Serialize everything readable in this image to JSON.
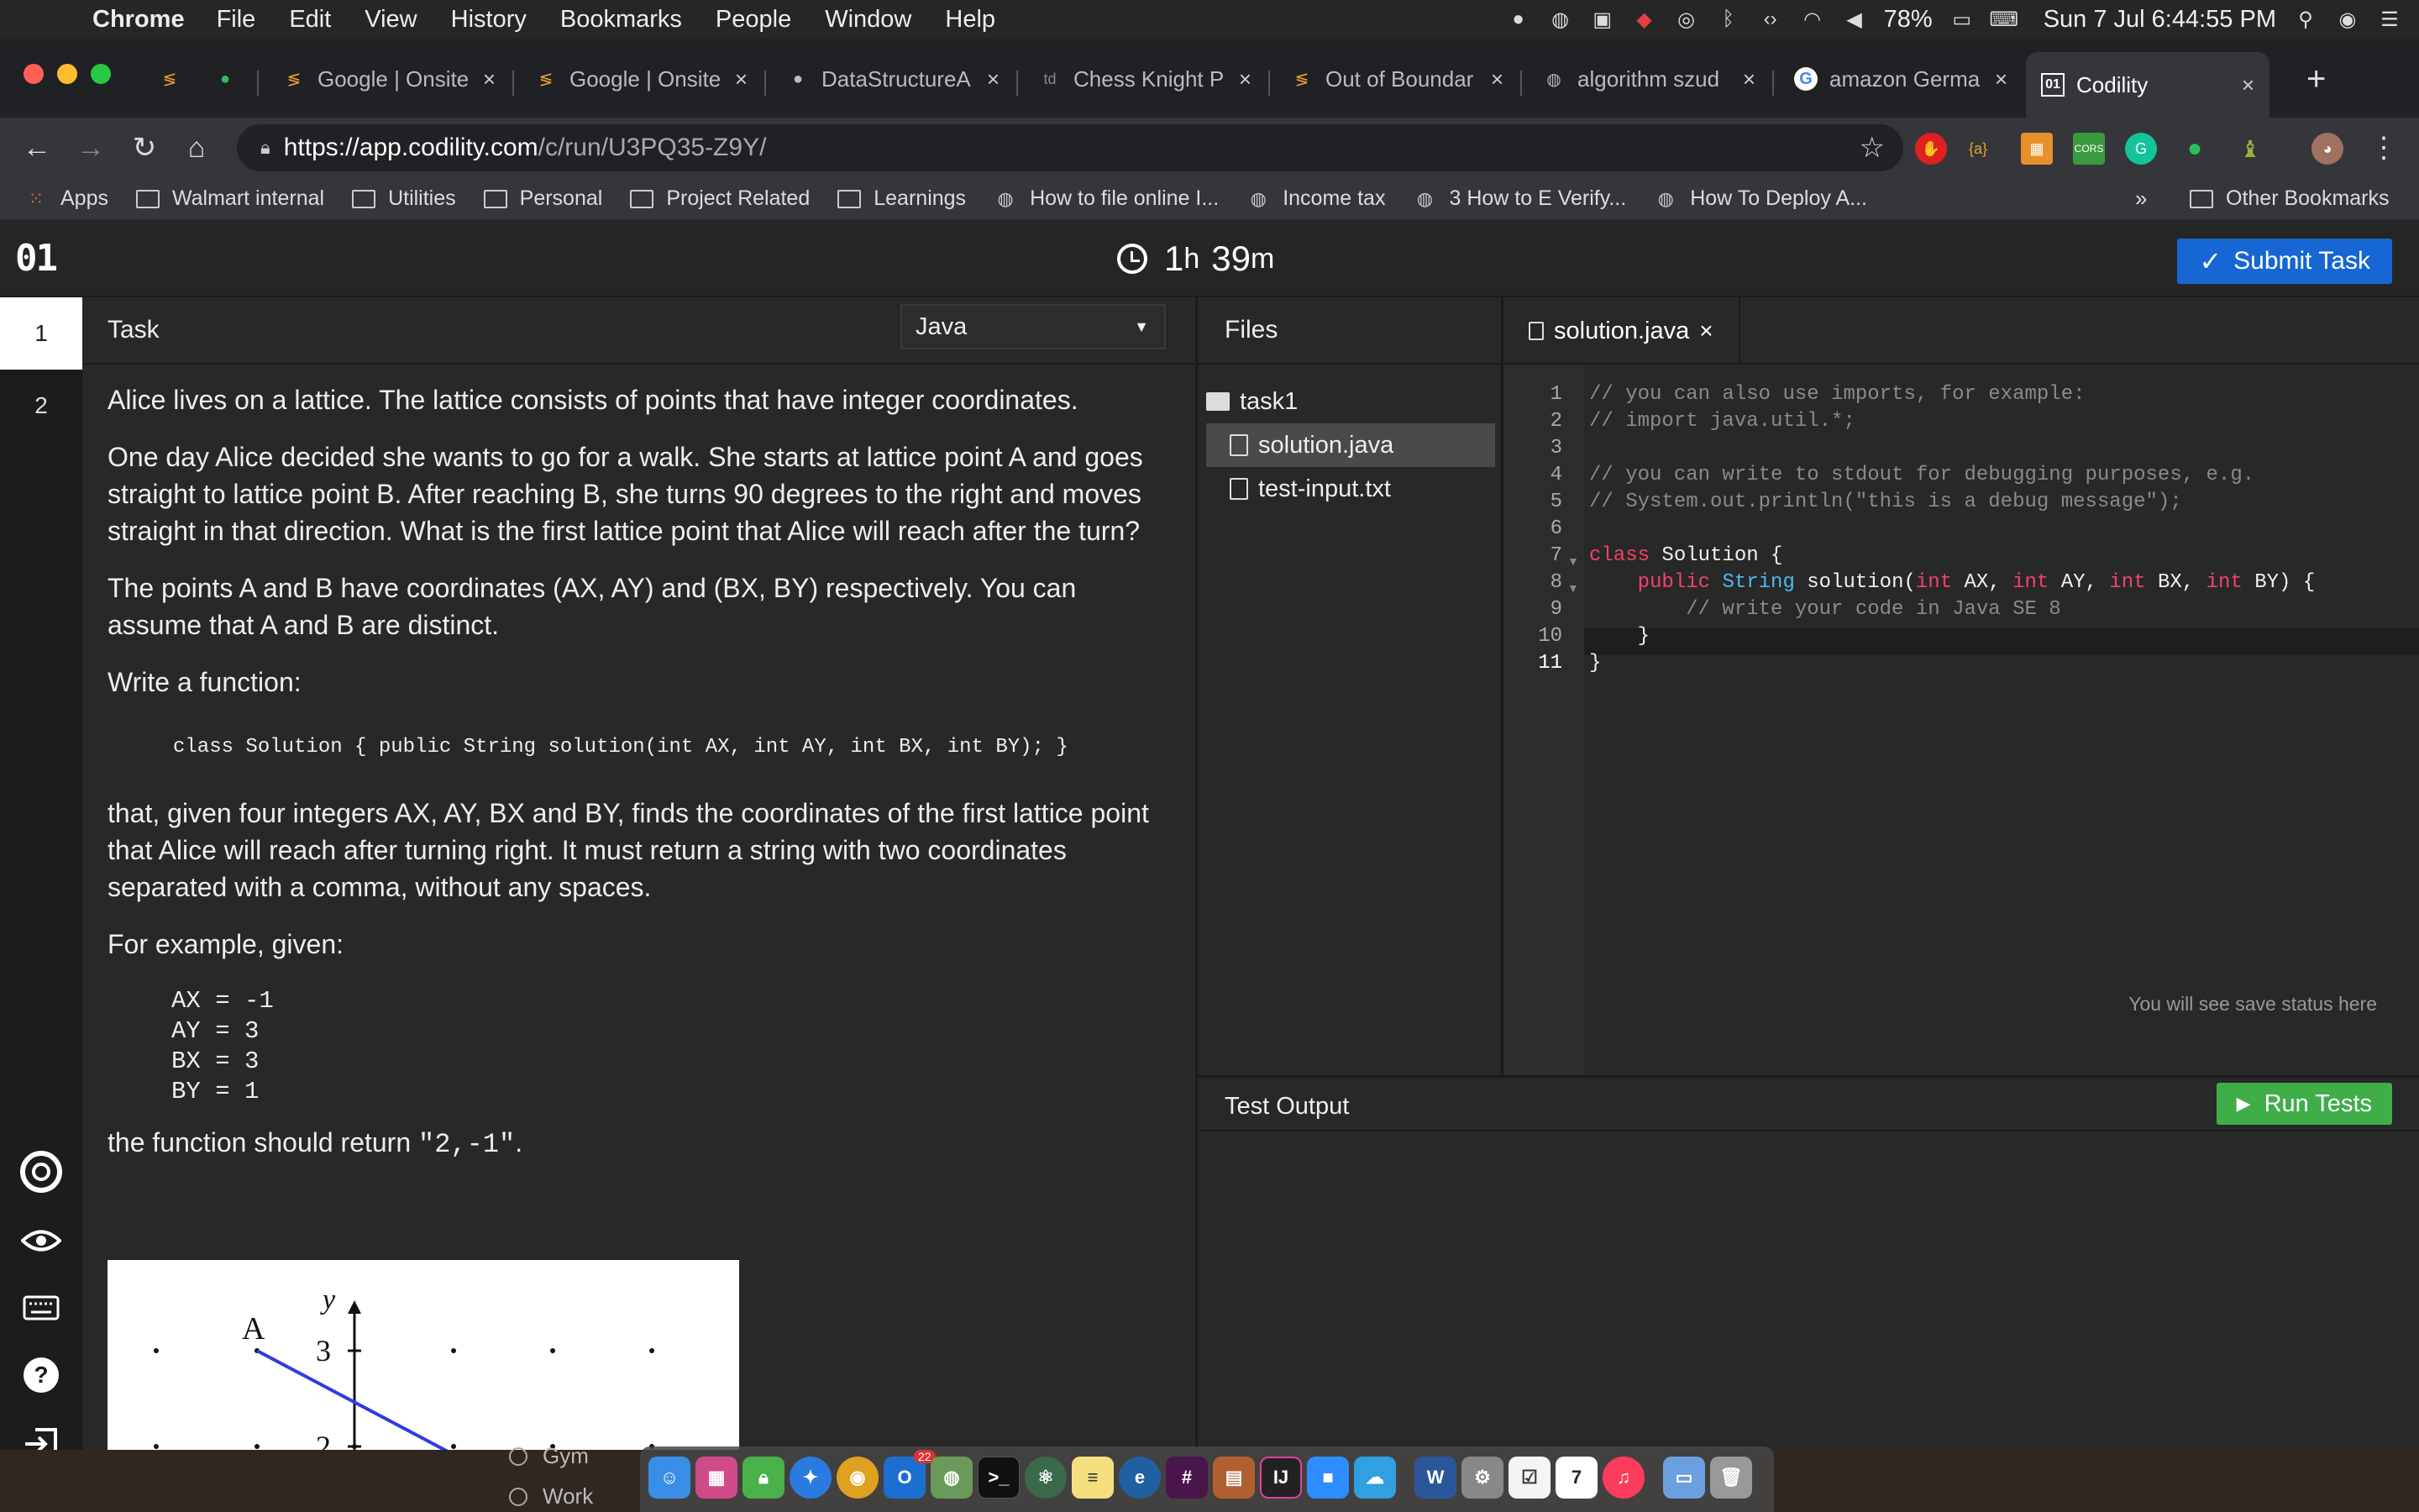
{
  "menubar": {
    "app": "Chrome",
    "items": [
      "File",
      "Edit",
      "View",
      "History",
      "Bookmarks",
      "People",
      "Window",
      "Help"
    ],
    "battery": "78%",
    "datetime": "Sun 7 Jul  6:44:55 PM"
  },
  "tabs": [
    {
      "label": "Google | Onsite",
      "icon": "sigma-icon"
    },
    {
      "label": "Google | Onsite",
      "icon": "sigma-icon"
    },
    {
      "label": "DataStructureA",
      "icon": "github-icon"
    },
    {
      "label": "Chess Knight P",
      "icon": "td-icon"
    },
    {
      "label": "Out of Boundar",
      "icon": "sigma-icon"
    },
    {
      "label": "algorithm szud",
      "icon": "globe-icon"
    },
    {
      "label": "amazon Germa",
      "icon": "google-icon"
    },
    {
      "label": "Codility",
      "icon": "codility-icon"
    }
  ],
  "address": {
    "host": "https://app.codility.com",
    "path": "/c/run/U3PQ35-Z9Y/"
  },
  "bookmarks": [
    {
      "label": "Apps",
      "icon": "apps-grid-icon"
    },
    {
      "label": "Walmart internal",
      "icon": "folder-icon"
    },
    {
      "label": "Utilities",
      "icon": "folder-icon"
    },
    {
      "label": "Personal",
      "icon": "folder-icon"
    },
    {
      "label": "Project Related",
      "icon": "folder-icon"
    },
    {
      "label": "Learnings",
      "icon": "folder-icon"
    },
    {
      "label": "How to file online I...",
      "icon": "globe-icon"
    },
    {
      "label": "Income tax",
      "icon": "globe-icon"
    },
    {
      "label": "3 How to E Verify...",
      "icon": "globe-icon"
    },
    {
      "label": "How To Deploy A...",
      "icon": "globe-icon"
    }
  ],
  "bookmarks_more": "»",
  "other_bookmarks": "Other Bookmarks",
  "app": {
    "logo": "01",
    "timer": {
      "hours": "1",
      "h": "h",
      "minutes": "39",
      "m": "m"
    },
    "submit_label": "Submit Task",
    "rail": [
      "1",
      "2"
    ],
    "task_header": "Task",
    "language": "Java",
    "task": {
      "p1": "Alice lives on a lattice. The lattice consists of points that have integer coordinates.",
      "p2": "One day Alice decided she wants to go for a walk. She starts at lattice point A and goes straight to lattice point B. After reaching B, she turns 90 degrees to the right and moves straight in that direction. What is the first lattice point that Alice will reach after the turn?",
      "p3": "The points A and B have coordinates (AX, AY) and (BX, BY) respectively. You can assume that A and B are distinct.",
      "p4": "Write a function:",
      "signature": "class Solution { public String solution(int AX, int AY, int BX, int BY); }",
      "p5": "that, given four integers AX, AY, BX and BY, finds the coordinates of the first lattice point that Alice will reach after turning right. It must return a string with two coordinates separated with a comma, without any spaces.",
      "p6": "For example, given:",
      "example": "AX = -1\nAY = 3\nBX = 3\nBY = 1",
      "p7_prefix": "the function should return ",
      "p7_value": "\"2,-1\"",
      "p7_suffix": "."
    },
    "figure": {
      "point_label": "A",
      "axis_label": "y",
      "tick3": "3",
      "tick2": "2"
    },
    "files_header": "Files",
    "files": {
      "folder": "task1",
      "items": [
        "solution.java",
        "test-input.txt"
      ]
    },
    "editor_tab": "solution.java",
    "code": [
      "// you can also use imports, for example:",
      "// import java.util.*;",
      "",
      "// you can write to stdout for debugging purposes, e.g.",
      "// System.out.println(\"this is a debug message\");",
      "",
      "class Solution {",
      "    public String solution(int AX, int AY, int BX, int BY) {",
      "        // write your code in Java SE 8",
      "    }",
      "}"
    ],
    "line_numbers": [
      "1",
      "2",
      "3",
      "4",
      "5",
      "6",
      "7",
      "8",
      "9",
      "10",
      "11"
    ],
    "save_status": "You will see save status here",
    "test_output": "Test Output",
    "run_label": "Run Tests"
  },
  "desktop": {
    "items": [
      "Gym",
      "Work"
    ]
  },
  "dock_badges": {
    "mail": "22",
    "calendar": "7"
  },
  "colors": {
    "submit": "#1666d4",
    "run": "#3fae49",
    "keyword": "#f0426a",
    "type": "#4fb8f0"
  }
}
